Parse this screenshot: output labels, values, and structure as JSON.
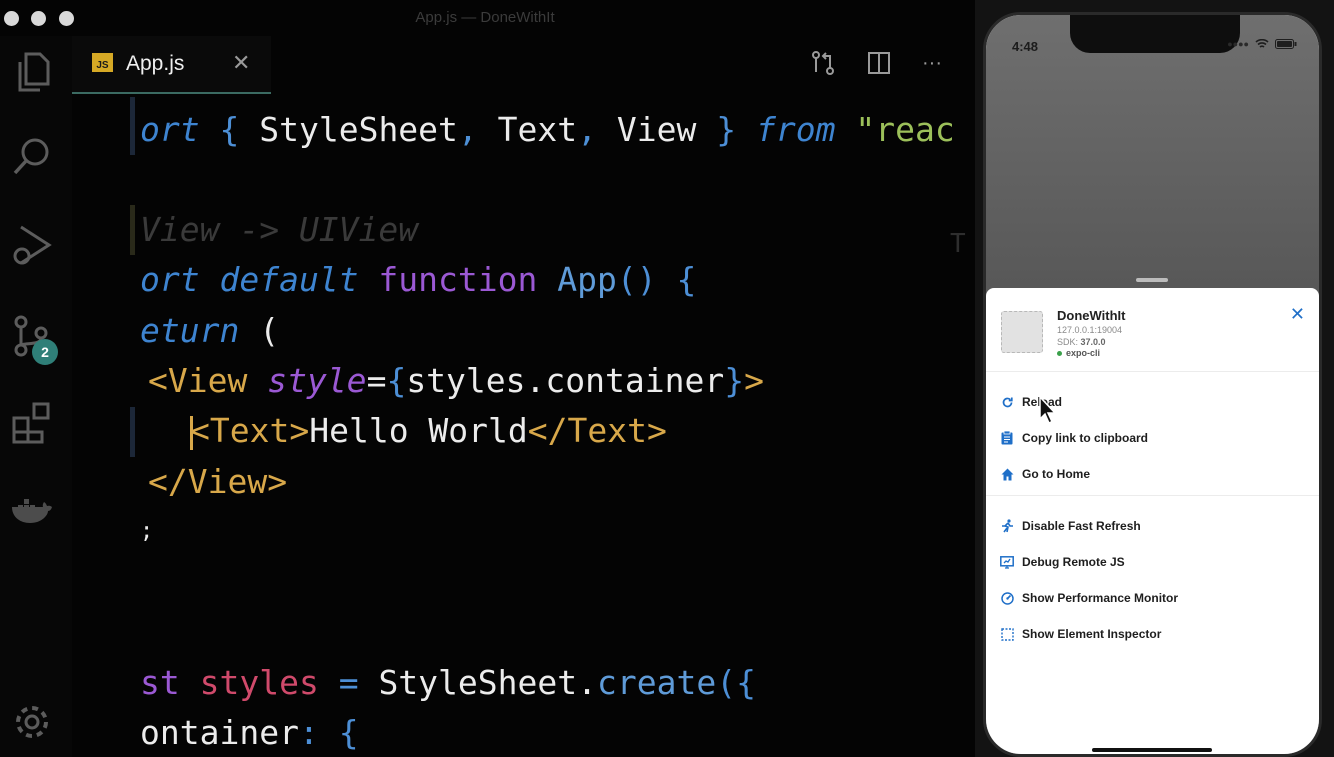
{
  "window": {
    "title": "App.js — DoneWithIt"
  },
  "activity_bar": {
    "scm_badge": "2"
  },
  "tab": {
    "icon_text": "JS",
    "label": "App.js"
  },
  "code": {
    "l1": {
      "a": "ort ",
      "b": "{ ",
      "c": "StyleSheet",
      "d": ", ",
      "e": "Text",
      "f": ", ",
      "g": "View",
      "h": " } ",
      "i": "from",
      "j": " \"reac"
    },
    "l2": "View -> UIView",
    "l3": {
      "a": "ort default",
      "b": " function",
      "c": " App",
      "d": "() {"
    },
    "l4": {
      "a": "eturn",
      "b": " ("
    },
    "l5": {
      "a": "<View",
      "b": " style",
      "c": "=",
      "d": "{",
      "e": "styles",
      "f": ".",
      "g": "container",
      "h": "}",
      "i": ">"
    },
    "l6": {
      "a": "<Text>",
      "b": "Hello World",
      "c": "</Text>"
    },
    "l7": "</View>",
    "l8": ";",
    "l9": {
      "a": "st",
      "b": " styles",
      "c": " = ",
      "d": "StyleSheet",
      "e": ".",
      "f": "create",
      "g": "({"
    },
    "l10": {
      "a": "ontainer",
      "b": ": {"
    },
    "right_stub": "T"
  },
  "phone": {
    "time": "4:48",
    "dev_menu": {
      "app_name": "DoneWithIt",
      "host": "127.0.0.1:19004",
      "sdk_label": "SDK: ",
      "sdk_version": "37.0.0",
      "runtime": "expo-cli",
      "items": [
        {
          "label": "Reload",
          "icon": "reload-icon"
        },
        {
          "label": "Copy link to clipboard",
          "icon": "clipboard-icon"
        },
        {
          "label": "Go to Home",
          "icon": "home-icon"
        },
        {
          "label": "Disable Fast Refresh",
          "icon": "run-icon"
        },
        {
          "label": "Debug Remote JS",
          "icon": "debug-monitor-icon"
        },
        {
          "label": "Show Performance Monitor",
          "icon": "speedometer-icon"
        },
        {
          "label": "Show Element Inspector",
          "icon": "inspector-icon"
        }
      ]
    }
  },
  "colors": {
    "accent_blue": "#1f6fc8",
    "scm_badge": "#2f7f78",
    "js_icon": "#d6a925"
  }
}
